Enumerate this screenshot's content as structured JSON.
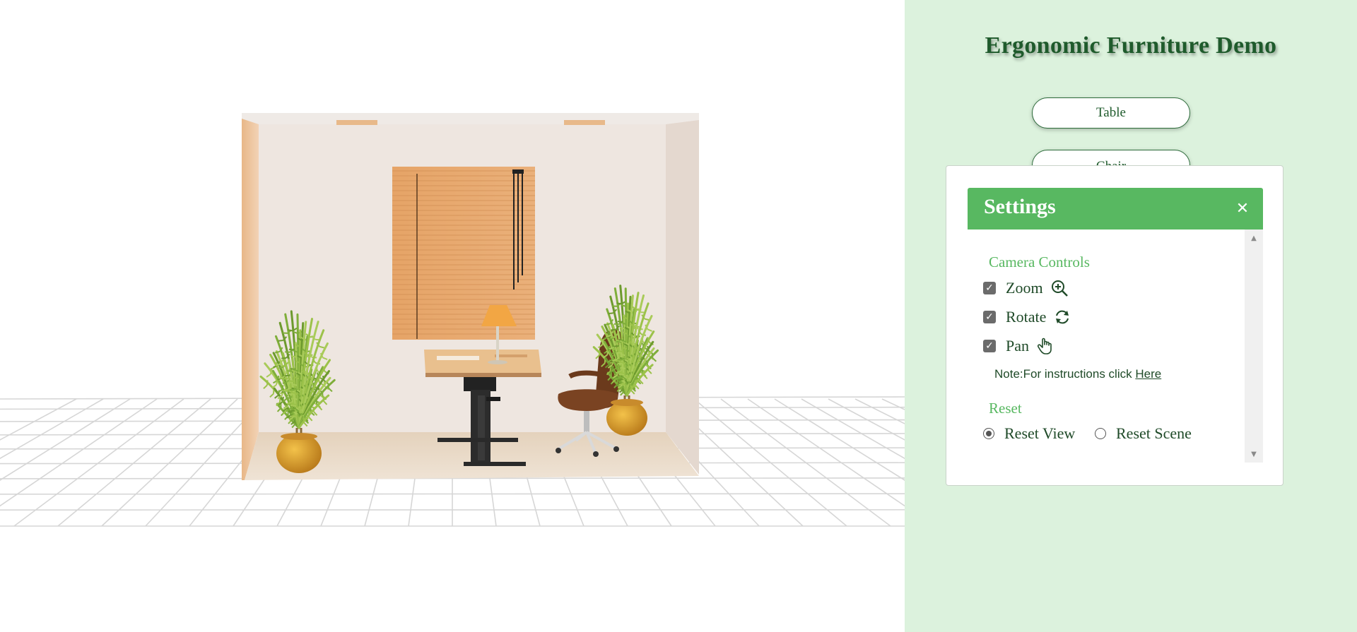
{
  "app": {
    "title": "Ergonomic Furniture Demo"
  },
  "furniture_buttons": {
    "table": "Table",
    "chair": "Chair"
  },
  "settings": {
    "title": "Settings",
    "close_symbol": "✕",
    "camera_controls": {
      "title": "Camera Controls",
      "zoom": {
        "label": "Zoom",
        "checked": true,
        "icon": "zoom-in-icon"
      },
      "rotate": {
        "label": "Rotate",
        "checked": true,
        "icon": "rotate-icon"
      },
      "pan": {
        "label": "Pan",
        "checked": true,
        "icon": "hand-pan-icon"
      }
    },
    "note": {
      "prefix": "Note:For instructions click ",
      "link": "Here"
    },
    "reset": {
      "title": "Reset",
      "view": {
        "label": "Reset View",
        "selected": true
      },
      "scene": {
        "label": "Reset Scene",
        "selected": false
      }
    }
  },
  "colors": {
    "panel_bg": "#dcf2dd",
    "header_green": "#58b861",
    "title_green": "#1f5b2c",
    "wall": "#eee6e0",
    "wood": "#e7a96b",
    "floor_grid": "#d6d6d6"
  }
}
